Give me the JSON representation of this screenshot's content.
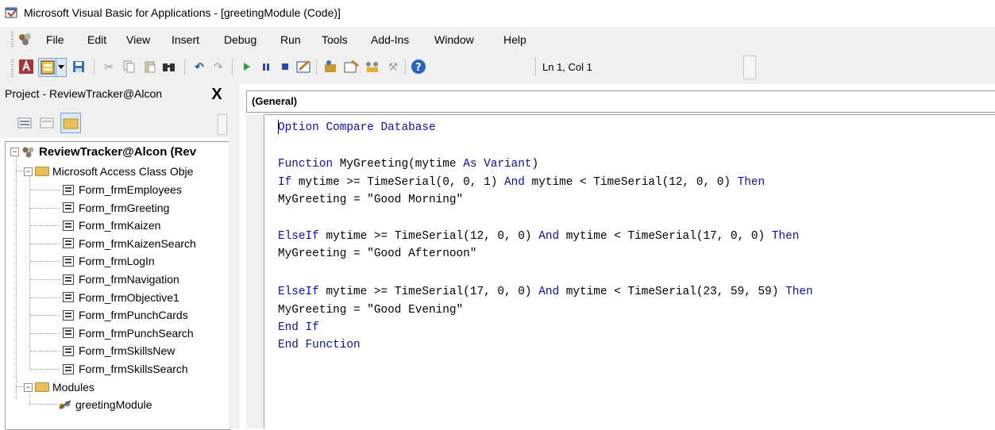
{
  "window": {
    "title": "Microsoft Visual Basic for Applications - [greetingModule (Code)]"
  },
  "menu": [
    "File",
    "Edit",
    "View",
    "Insert",
    "Debug",
    "Run",
    "Tools",
    "Add-Ins",
    "Window",
    "Help"
  ],
  "toolbar": {
    "status": "Ln 1, Col 1",
    "icons": [
      "access-icon",
      "insert-userform-icon",
      "dropdown-arrow-icon",
      "save-icon",
      "cut-icon",
      "copy-icon",
      "paste-icon",
      "find-icon",
      "undo-icon",
      "redo-icon",
      "run-icon",
      "break-icon",
      "reset-icon",
      "design-mode-icon",
      "project-explorer-icon",
      "properties-window-icon",
      "object-browser-icon",
      "toolbox-icon",
      "help-icon"
    ]
  },
  "project_panel": {
    "title": "Project - ReviewTracker@Alcon",
    "close": "X",
    "root": "ReviewTracker@Alcon (Rev",
    "folders": {
      "class_objects": "Microsoft Access Class Obje",
      "modules": "Modules"
    },
    "forms": [
      "Form_frmEmployees",
      "Form_frmGreeting",
      "Form_frmKaizen",
      "Form_frmKaizenSearch",
      "Form_frmLogIn",
      "Form_frmNavigation",
      "Form_frmObjective1",
      "Form_frmPunchCards",
      "Form_frmPunchSearch",
      "Form_frmSkillsNew",
      "Form_frmSkillsSearch"
    ],
    "module": "greetingModule"
  },
  "code_window": {
    "object_dropdown": "(General)",
    "lines": [
      {
        "k": "Option Compare Database",
        "t": ""
      },
      {
        "k": "",
        "t": ""
      },
      {
        "k": "Function",
        "t": " MyGreeting(mytime ",
        "k2": "As Variant",
        "t2": ")"
      },
      {
        "k": "If",
        "t": " mytime >= TimeSerial(0, 0, 1) ",
        "k2": "And",
        "t2": " mytime < TimeSerial(12, 0, 0) ",
        "k3": "Then"
      },
      {
        "k": "",
        "t": "MyGreeting = \"Good Morning\""
      },
      {
        "k": "",
        "t": ""
      },
      {
        "k": "ElseIf",
        "t": " mytime >= TimeSerial(12, 0, 0) ",
        "k2": "And",
        "t2": " mytime < TimeSerial(17, 0, 0) ",
        "k3": "Then"
      },
      {
        "k": "",
        "t": "MyGreeting = \"Good Afternoon\""
      },
      {
        "k": "",
        "t": ""
      },
      {
        "k": "ElseIf",
        "t": " mytime >= TimeSerial(17, 0, 0) ",
        "k2": "And",
        "t2": " mytime < TimeSerial(23, 59, 59) ",
        "k3": "Then"
      },
      {
        "k": "",
        "t": "MyGreeting = \"Good Evening\""
      },
      {
        "k": "End If",
        "t": ""
      },
      {
        "k": "End Function",
        "t": ""
      }
    ]
  },
  "colors": {
    "keyword": "#1010a0",
    "chrome": "#f0f0f0"
  }
}
